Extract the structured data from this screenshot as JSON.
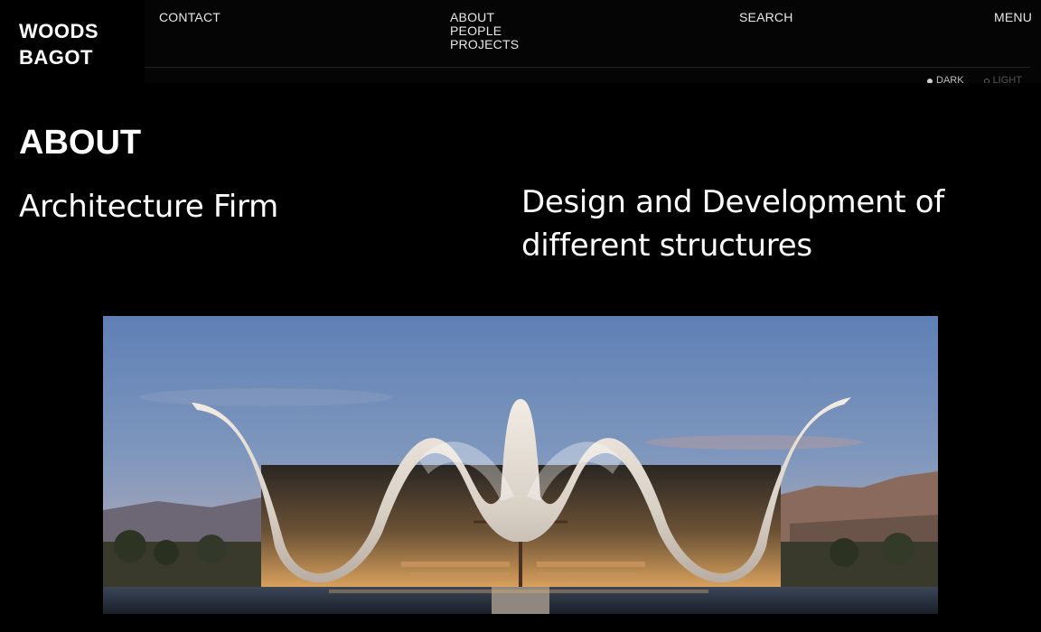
{
  "brand": {
    "line1": "WOODS",
    "line2": "BAGOT"
  },
  "nav": {
    "contact": "CONTACT",
    "about": "ABOUT",
    "people": "PEOPLE",
    "projects": "PROJECTS",
    "search": "SEARCH",
    "menu": "MENU"
  },
  "theme_toggle": {
    "dark": "DARK",
    "light": "LIGHT",
    "selected": "DARK"
  },
  "main": {
    "section_title": "ABOUT",
    "tagline_left": "Architecture Firm",
    "tagline_right": "Design and Development of different structures"
  },
  "colors": {
    "background": "#000000",
    "text": "#ffffff",
    "nav_text": "#e8e8e8"
  }
}
